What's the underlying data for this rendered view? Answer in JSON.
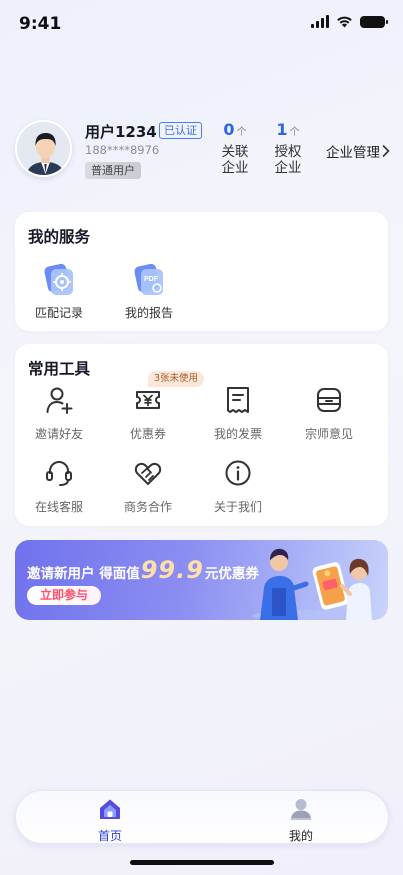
{
  "status_bar": {
    "time": "9:41"
  },
  "profile": {
    "name": "用户1234",
    "verify_badge": "已认证",
    "phone": "188****8976",
    "level": "普通用户",
    "linked": {
      "count": "0",
      "unit": "个",
      "label_line1": "关联",
      "label_line2": "企业"
    },
    "authorized": {
      "count": "1",
      "unit": "个",
      "label_line1": "授权",
      "label_line2": "企业"
    },
    "enterprise_link": "企业管理"
  },
  "services": {
    "title": "我的服务",
    "items": [
      {
        "label": "匹配记录",
        "icon": "target-doc-icon"
      },
      {
        "label": "我的报告",
        "icon": "pdf-report-icon"
      }
    ]
  },
  "tools": {
    "title": "常用工具",
    "coupon_tag": "3张未使用",
    "items": [
      {
        "label": "邀请好友",
        "icon": "add-user-icon"
      },
      {
        "label": "优惠券",
        "icon": "coupon-icon"
      },
      {
        "label": "我的发票",
        "icon": "invoice-icon"
      },
      {
        "label": "宗师意见",
        "icon": "feedback-icon"
      },
      {
        "label": "在线客服",
        "icon": "headset-icon"
      },
      {
        "label": "商务合作",
        "icon": "handshake-icon"
      },
      {
        "label": "关于我们",
        "icon": "info-icon"
      }
    ]
  },
  "banner": {
    "text_before": "邀请新用户 得面值",
    "amount": "99.9",
    "text_after": "元优惠券",
    "button": "立即参与"
  },
  "tabbar": {
    "tabs": [
      {
        "label": "首页",
        "icon": "home-icon",
        "active": true
      },
      {
        "label": "我的",
        "icon": "profile-icon",
        "active": false
      }
    ]
  },
  "colors": {
    "accent": "#2f63e6",
    "active_tab": "#2d3fd8",
    "banner_start": "#6f72ec",
    "banner_end": "#c9d3fb"
  }
}
